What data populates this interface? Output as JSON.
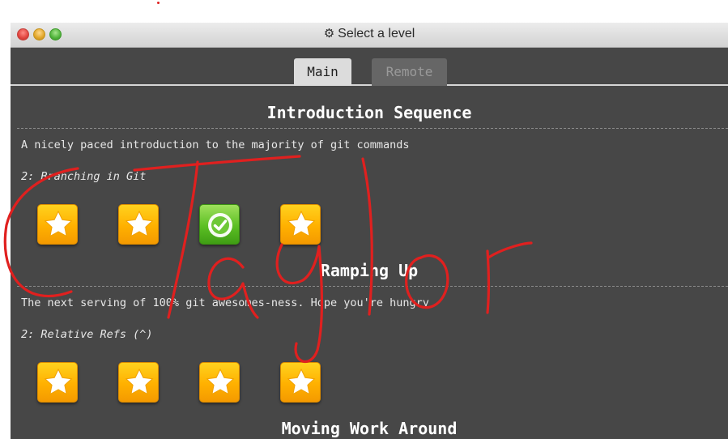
{
  "window": {
    "title": "Select a level",
    "title_icon": "gear-icon"
  },
  "tabs": [
    {
      "label": "Main",
      "active": true
    },
    {
      "label": "Remote",
      "active": false
    }
  ],
  "sections": [
    {
      "title": "Introduction Sequence",
      "description": "A nicely paced introduction to the majority of git commands",
      "subtitle": "2: Branching in Git",
      "levels": [
        "star-icon",
        "star-icon",
        "checkmark-icon",
        "star-icon"
      ]
    },
    {
      "title": "Ramping Up",
      "description": "The next serving of 100% git awesomes-ness. Hope you're hungry",
      "subtitle": "2: Relative Refs (^)",
      "levels": [
        "star-icon",
        "star-icon",
        "star-icon",
        "star-icon"
      ]
    },
    {
      "title": "Moving Work Around"
    }
  ],
  "overlay": {
    "handwriting": "Taylor",
    "ink_color": "#e0201f"
  },
  "colors": {
    "window_bg": "#474747",
    "tab_active": "#dcdcdc",
    "tab_inactive": "#666666",
    "star_tile": "#ffb000",
    "done_tile": "#5cbf24"
  }
}
